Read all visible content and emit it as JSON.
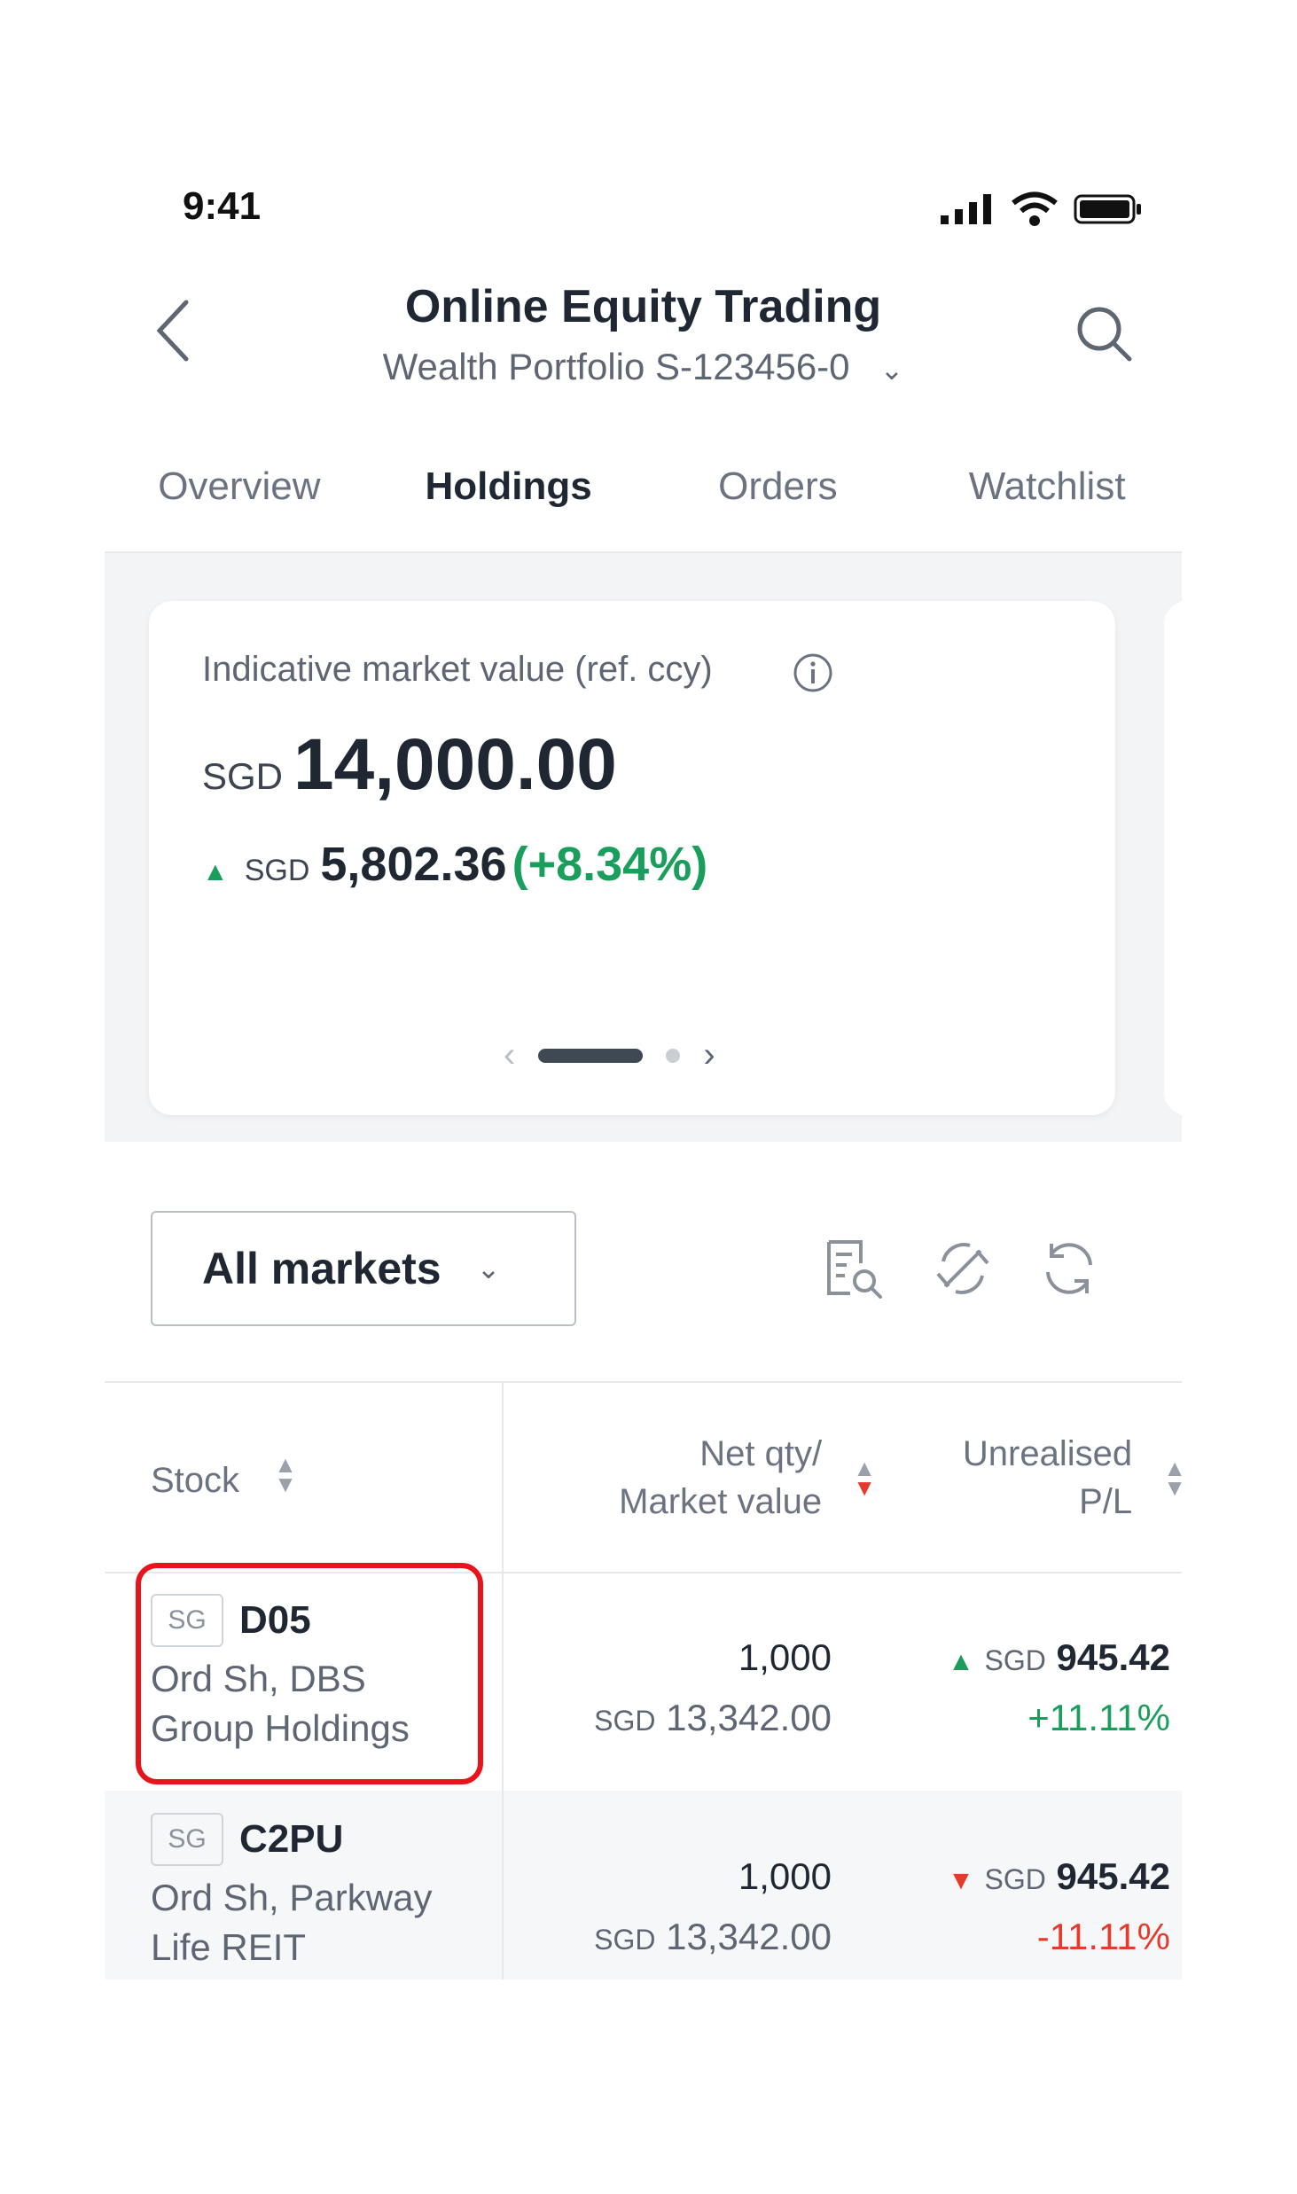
{
  "status_bar": {
    "time": "9:41"
  },
  "header": {
    "title": "Online Equity Trading",
    "subtitle": "Wealth Portfolio S-123456-0"
  },
  "tabs": [
    {
      "label": "Overview",
      "active": false
    },
    {
      "label": "Holdings",
      "active": true
    },
    {
      "label": "Orders",
      "active": false
    },
    {
      "label": "Watchlist",
      "active": false
    }
  ],
  "summary": {
    "label": "Indicative market value (ref. ccy)",
    "currency": "SGD",
    "value": "14,000.00",
    "pl_currency": "SGD",
    "pl_amount": "5,802.36",
    "pl_percent": "(+8.34%)"
  },
  "filter": {
    "market_label": "All markets"
  },
  "table": {
    "headers": {
      "stock": "Stock",
      "qty_line1": "Net qty/",
      "qty_line2": "Market value",
      "pl_line1": "Unrealised",
      "pl_line2": "P/L"
    },
    "rows": [
      {
        "market": "SG",
        "symbol": "D05",
        "name_line1": "Ord Sh, DBS",
        "name_line2": "Group Holdings",
        "qty": "1,000",
        "mv_currency": "SGD",
        "market_value": "13,342.00",
        "pl_currency": "SGD",
        "pl_amount": "945.42",
        "pl_percent": "+11.11%",
        "direction": "up"
      },
      {
        "market": "SG",
        "symbol": "C2PU",
        "name_line1": "Ord Sh, Parkway",
        "name_line2": "Life REIT",
        "qty": "1,000",
        "mv_currency": "SGD",
        "market_value": "13,342.00",
        "pl_currency": "SGD",
        "pl_amount": "945.42",
        "pl_percent": "-11.11%",
        "direction": "down"
      }
    ]
  },
  "colors": {
    "accent_tab": "#e0a156",
    "positive": "#1a9e5c",
    "negative": "#e53b2c",
    "highlight": "#e8141c"
  }
}
